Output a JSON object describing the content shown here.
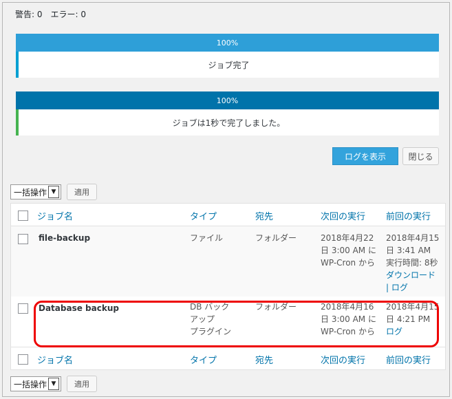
{
  "status_line": "警告: 0　エラー: 0",
  "progress": [
    {
      "label": "100%",
      "value": 100,
      "message": "ジョブ完了"
    },
    {
      "label": "100%",
      "value": 100,
      "message": "ジョブは1秒で完了しました。"
    }
  ],
  "buttons": {
    "show_log": "ログを表示",
    "close": "閉じる"
  },
  "bulk": {
    "select_label": "一括操作",
    "apply_label": "適用"
  },
  "columns": [
    "ジョブ名",
    "タイプ",
    "宛先",
    "次回の実行",
    "前回の実行"
  ],
  "rows": [
    {
      "name": "file-backup",
      "type": [
        "ファイル"
      ],
      "dest": "フォルダー",
      "next": [
        "2018年4月22",
        "日 3:00 AM に",
        "WP-Cron から"
      ],
      "last": [
        "2018年4月15",
        "日 3:41 AM",
        "実行時間: 8秒"
      ],
      "last_links": [
        "ダウンロード",
        "| ログ"
      ]
    },
    {
      "name": "Database backup",
      "type": [
        "DB バック",
        "アップ",
        "プラグイン"
      ],
      "dest": "フォルダー",
      "next": [
        "2018年4月16",
        "日 3:00 AM に",
        "WP-Cron から"
      ],
      "last": [
        "2018年4月15",
        "日 4:21 PM"
      ],
      "last_links": [
        "ログ"
      ]
    }
  ],
  "colors": {
    "bar_light": "#2e9fd8",
    "bar_dark": "#0073aa",
    "link": "#0073aa",
    "highlight": "#e00000"
  }
}
